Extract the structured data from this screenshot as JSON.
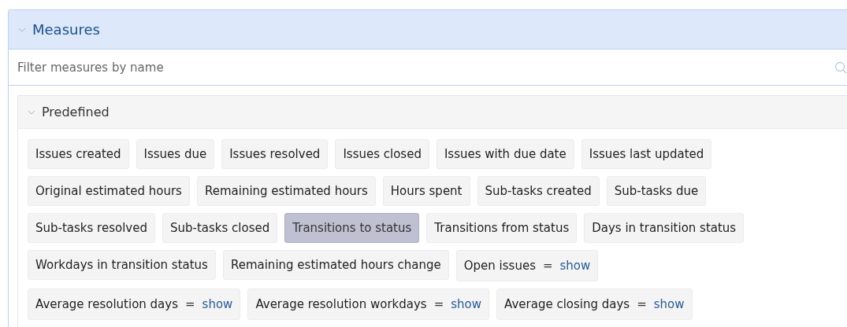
{
  "panel": {
    "title": "Measures",
    "expanded": true
  },
  "filter": {
    "placeholder": "Filter measures by name"
  },
  "section": {
    "title": "Predefined",
    "expanded": true,
    "measures": [
      {
        "label": "Issues created",
        "selected": false
      },
      {
        "label": "Issues due",
        "selected": false
      },
      {
        "label": "Issues resolved",
        "selected": false
      },
      {
        "label": "Issues closed",
        "selected": false
      },
      {
        "label": "Issues with due date",
        "selected": false
      },
      {
        "label": "Issues last updated",
        "selected": false
      },
      {
        "label": "Original estimated hours",
        "selected": false
      },
      {
        "label": "Remaining estimated hours",
        "selected": false
      },
      {
        "label": "Hours spent",
        "selected": false
      },
      {
        "label": "Sub-tasks created",
        "selected": false
      },
      {
        "label": "Sub-tasks due",
        "selected": false
      },
      {
        "label": "Sub-tasks resolved",
        "selected": false
      },
      {
        "label": "Sub-tasks closed",
        "selected": false
      },
      {
        "label": "Transitions to status",
        "selected": true
      },
      {
        "label": "Transitions from status",
        "selected": false
      },
      {
        "label": "Days in transition status",
        "selected": false
      },
      {
        "label": "Workdays in transition status",
        "selected": false
      },
      {
        "label": "Remaining estimated hours change",
        "selected": false
      },
      {
        "label": "Open issues",
        "selected": false,
        "operator": "=",
        "link": "show"
      },
      {
        "label": "Average resolution days",
        "selected": false,
        "operator": "=",
        "link": "show"
      },
      {
        "label": "Average resolution workdays",
        "selected": false,
        "operator": "=",
        "link": "show"
      },
      {
        "label": "Average closing days",
        "selected": false,
        "operator": "=",
        "link": "show"
      }
    ]
  }
}
